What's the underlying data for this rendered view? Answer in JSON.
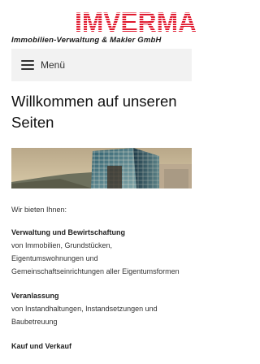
{
  "logo": {
    "wordmark": "IMVERMA",
    "company_name": "Immobilien-Verwaltung & Makler GmbH"
  },
  "nav": {
    "menu_label": "Menü"
  },
  "main": {
    "heading": "Willkommen auf unseren Seiten",
    "intro": "Wir bieten Ihnen:",
    "sections": [
      {
        "title": "Verwaltung und Bewirtschaftung",
        "lines": [
          "von Immobilien, Grundstücken,",
          "Eigentumswohnungen und",
          "Gemeinschaftseinrichtungen aller Eigentumsformen"
        ]
      },
      {
        "title": "Veranlassung",
        "lines": [
          "von Instandhaltungen, Instandsetzungen und",
          "Baubetreuung"
        ]
      },
      {
        "title": "Kauf und Verkauf",
        "lines": []
      }
    ]
  },
  "colors": {
    "brand_red": "#e0182d",
    "menu_bg": "#f2f2f2",
    "banner_sky": "#c9b48f"
  }
}
